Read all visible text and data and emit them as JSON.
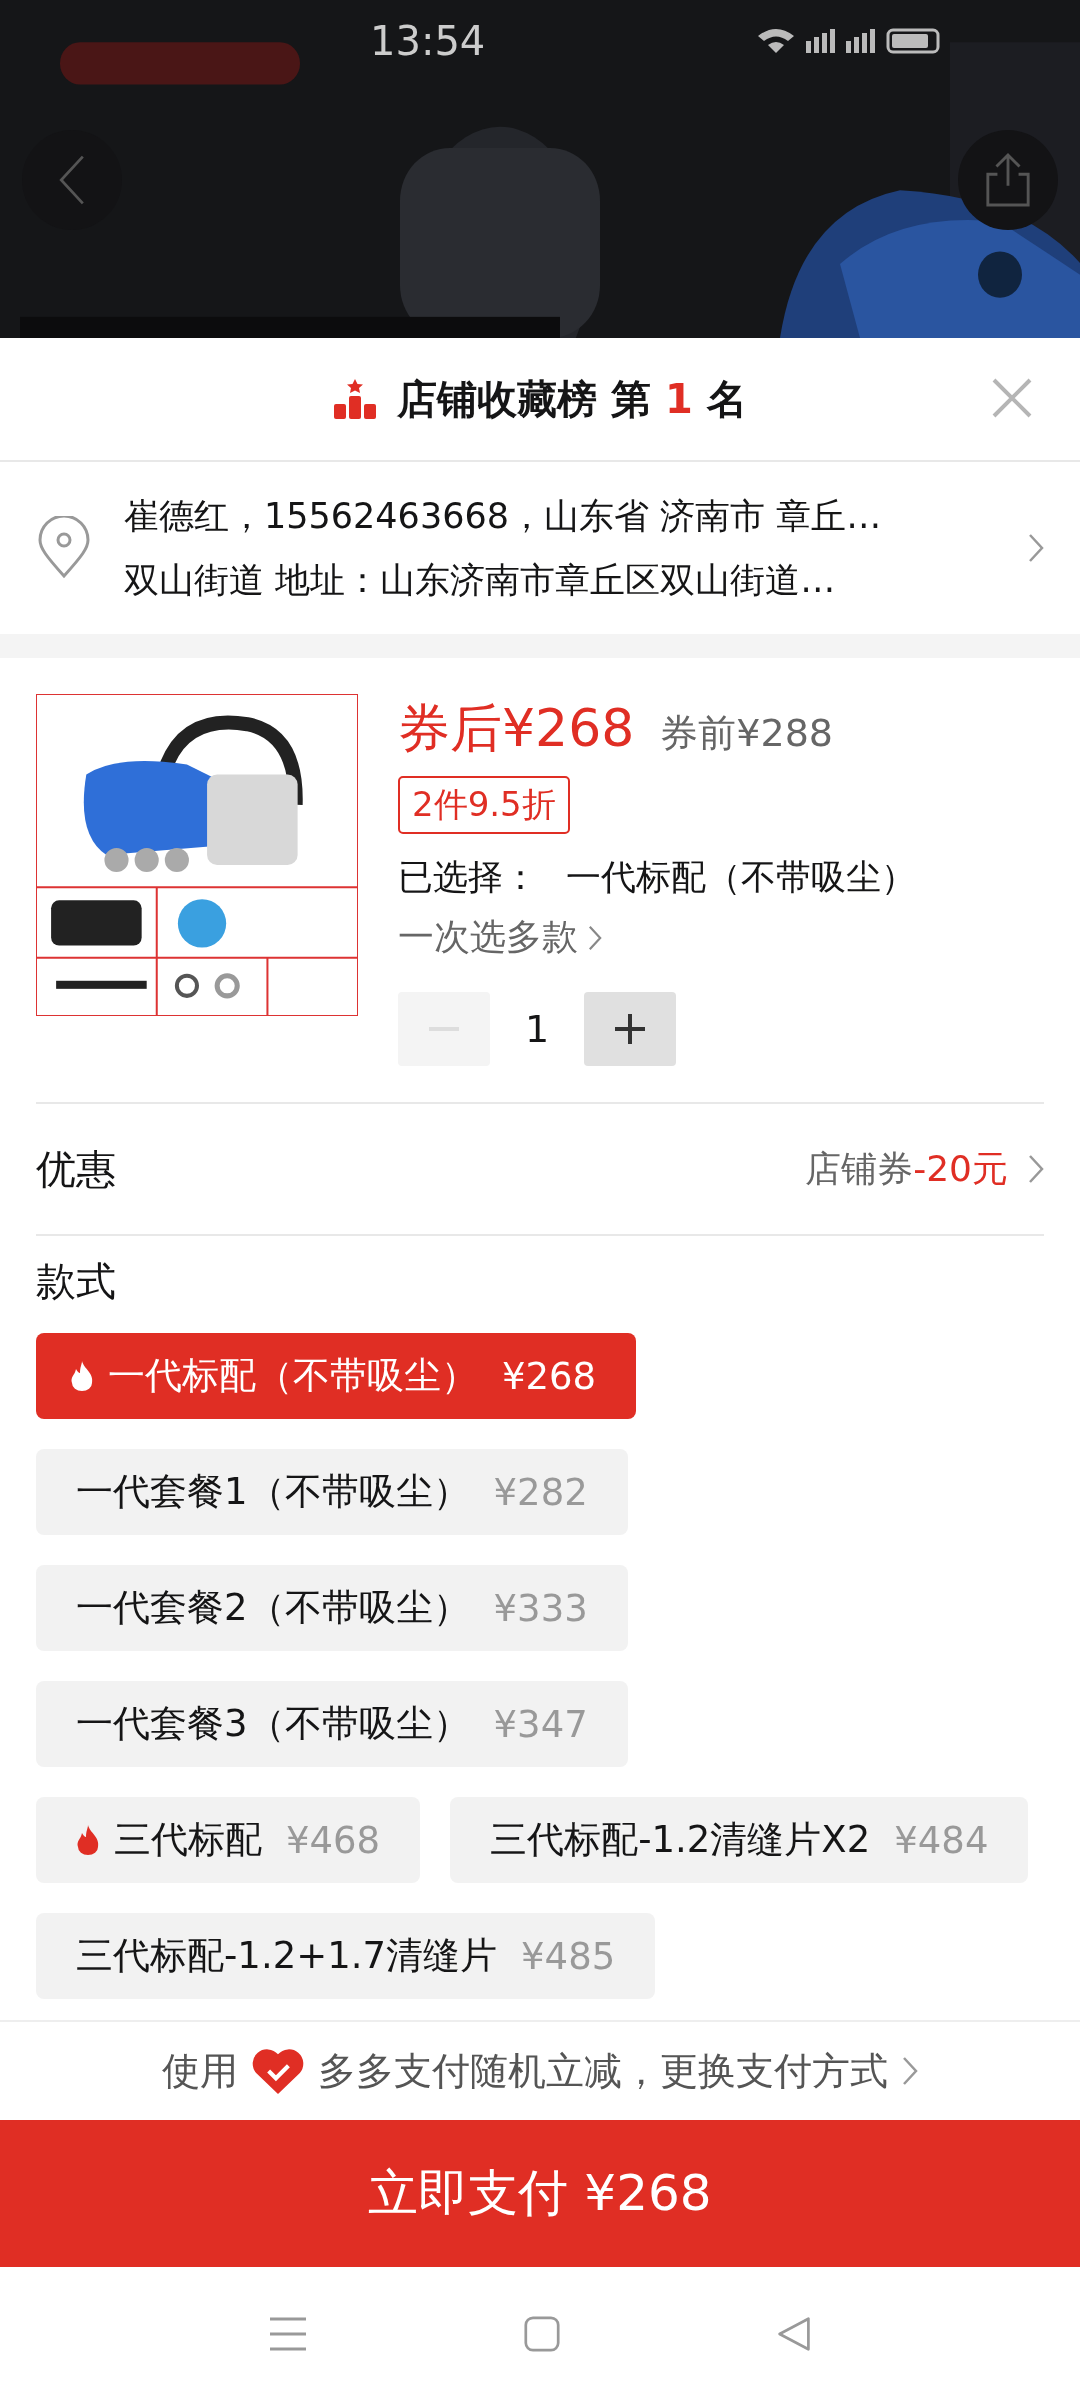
{
  "status_bar": {
    "time": "13:54"
  },
  "sheet_header": {
    "title_prefix": "店铺收藏榜 第",
    "rank": "1",
    "title_suffix": "名"
  },
  "address": {
    "line_1": "崔德红，15562463668，山东省 济南市 章丘…",
    "line_2": "双山街道 地址：山东济南市章丘区双山街道…"
  },
  "product": {
    "price_after": "券后¥268",
    "price_before": "券前¥288",
    "discount_tag": "2件9.5折",
    "selected_label": "已选择：",
    "selected_value": "一代标配（不带吸尘）",
    "multi_link": "一次选多款",
    "quantity": "1",
    "minus_disabled": true
  },
  "promotion": {
    "label": "优惠",
    "coupon_label": "店铺券",
    "coupon_amount": "-20元"
  },
  "styles": {
    "label": "款式",
    "options": [
      {
        "name": "一代标配（不带吸尘）",
        "price": "¥268",
        "selected": true,
        "hot": true
      },
      {
        "name": "一代套餐1（不带吸尘）",
        "price": "¥282",
        "selected": false,
        "hot": false
      },
      {
        "name": "一代套餐2（不带吸尘）",
        "price": "¥333",
        "selected": false,
        "hot": false
      },
      {
        "name": "一代套餐3（不带吸尘）",
        "price": "¥347",
        "selected": false,
        "hot": false
      },
      {
        "name": "三代标配",
        "price": "¥468",
        "selected": false,
        "hot": true
      },
      {
        "name": "三代标配-1.2清缝片X2",
        "price": "¥484",
        "selected": false,
        "hot": false
      },
      {
        "name": "三代标配-1.2+1.7清缝片",
        "price": "¥485",
        "selected": false,
        "hot": false
      }
    ]
  },
  "payment_tip": {
    "prefix": "使用",
    "text": "多多支付随机立减，更换支付方式"
  },
  "pay_button": "立即支付 ¥268"
}
